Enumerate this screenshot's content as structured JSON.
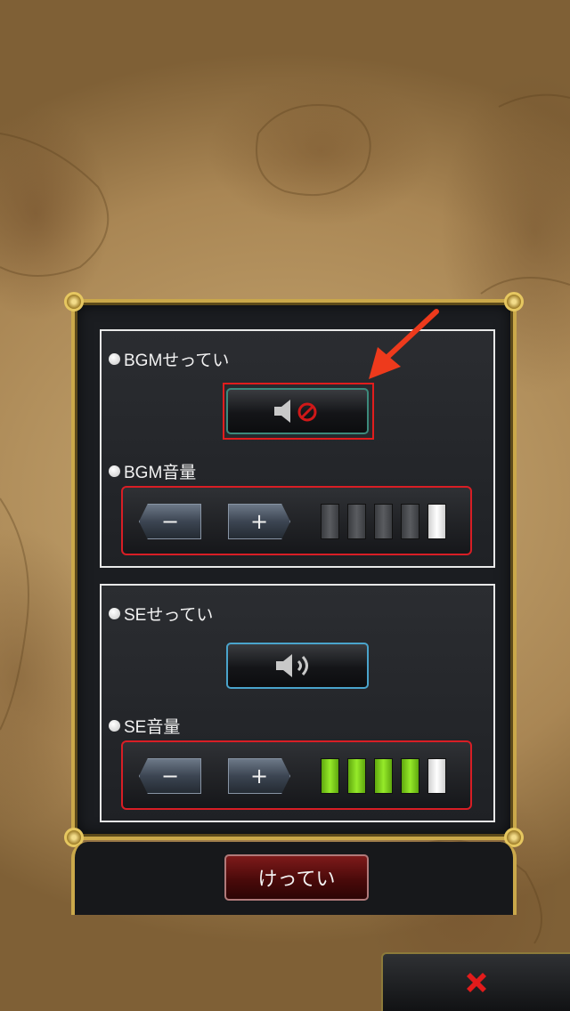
{
  "bgm": {
    "setting_label": "BGMせってい",
    "setting_state": "off",
    "volume_label": "BGM音量",
    "minus_label": "−",
    "plus_label": "+",
    "volume_level": 0,
    "volume_max": 5
  },
  "se": {
    "setting_label": "SEせってい",
    "setting_state": "on",
    "volume_label": "SE音量",
    "minus_label": "−",
    "plus_label": "+",
    "volume_level": 4,
    "volume_max": 5
  },
  "footer": {
    "confirm_label": "けってい"
  },
  "icons": {
    "bgm_toggle": "speaker-muted-icon",
    "se_toggle": "speaker-sound-icon",
    "close": "close-x-icon",
    "annotation": "red-arrow-icon"
  },
  "colors": {
    "frame_gold": "#caa84a",
    "panel_border_red": "#d81e25",
    "level_green": "#96ea2a",
    "confirm_red": "#7e1a1a",
    "close_x_red": "#e21b1b"
  }
}
